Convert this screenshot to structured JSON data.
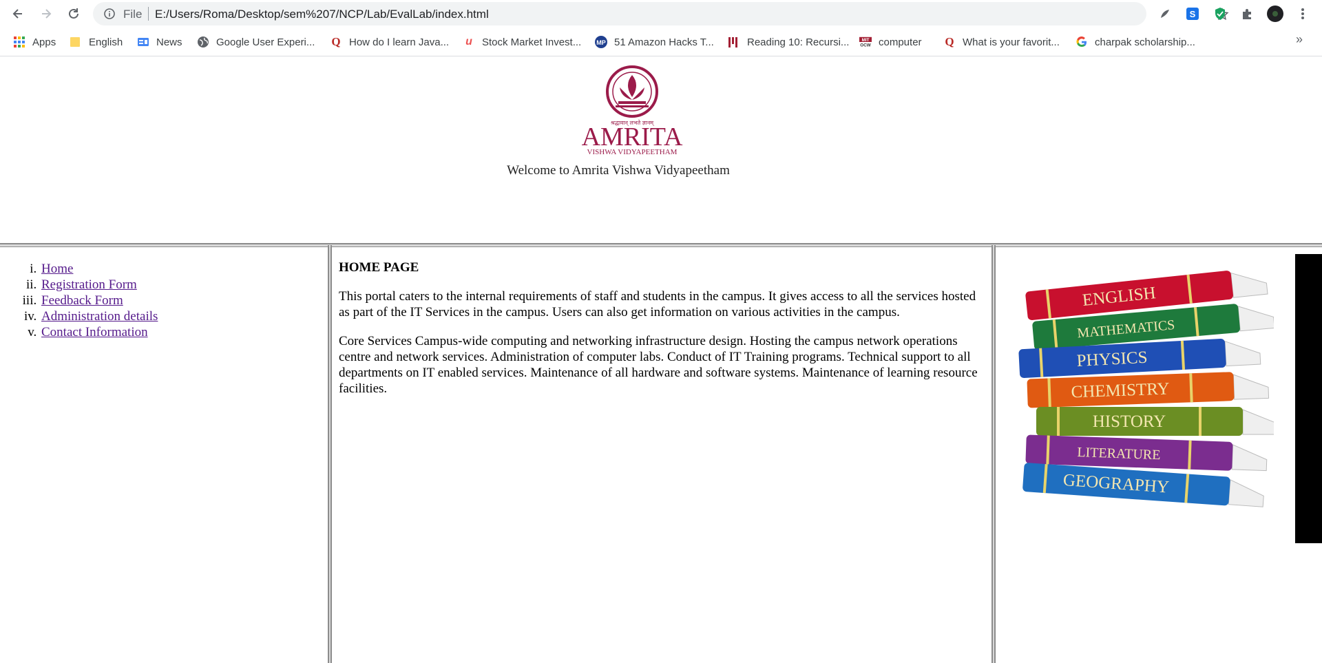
{
  "browser": {
    "scheme_label": "File",
    "url": "E:/Users/Roma/Desktop/sem%207/NCP/Lab/EvalLab/index.html",
    "bookmarks": [
      {
        "label": "Apps",
        "icon": "apps-grid-icon"
      },
      {
        "label": "English",
        "icon": "folder-icon"
      },
      {
        "label": "News",
        "icon": "google-news-icon"
      },
      {
        "label": "Google User Experi...",
        "icon": "globe-icon"
      },
      {
        "label": "How do I learn Java...",
        "icon": "quora-icon"
      },
      {
        "label": "Stock Market Invest...",
        "icon": "udemy-icon"
      },
      {
        "label": "51 Amazon Hacks T...",
        "icon": "mp-icon"
      },
      {
        "label": "Reading 10: Recursi...",
        "icon": "mit-reading-icon"
      },
      {
        "label": "computer",
        "icon": "mit-ocw-icon"
      },
      {
        "label": "What is your favorit...",
        "icon": "quora-icon"
      },
      {
        "label": "charpak scholarship...",
        "icon": "google-icon"
      }
    ],
    "more_label": "»"
  },
  "header": {
    "logo_title": "AMRITA",
    "logo_subtitle": "VISHWA VIDYAPEETHAM",
    "logo_motto": "श्रद्धावान् लभते ज्ञानम्",
    "welcome": "Welcome to Amrita Vishwa Vidyapeetham"
  },
  "menu": {
    "items": [
      {
        "label": "Home"
      },
      {
        "label": "Registration Form"
      },
      {
        "label": "Feedback Form"
      },
      {
        "label": "Administration details"
      },
      {
        "label": "Contact Information"
      }
    ]
  },
  "main": {
    "heading": "HOME PAGE",
    "paragraphs": [
      "This portal caters to the internal requirements of staff and students in the campus. It gives access to all the services hosted as part of the IT Services in the campus. Users can also get information on various activities in the campus.",
      "Core Services Campus-wide computing and networking infrastructure design. Hosting the campus network operations centre and network services. Administration of computer labs. Conduct of IT Training programs. Technical support to all departments on IT enabled services. Maintenance of all hardware and software systems. Maintenance of learning resource facilities."
    ]
  },
  "sidebar_image": {
    "book_titles": [
      "ENGLISH",
      "MATHEMATICS",
      "PHYSICS",
      "CHEMISTRY",
      "HISTORY",
      "LITERATURE",
      "GEOGRAPHY"
    ],
    "book_colors": [
      "#c8102e",
      "#1e7a3c",
      "#1f4fb5",
      "#e05a12",
      "#6b8e23",
      "#7b2d8f",
      "#1f6fc0"
    ]
  },
  "colors": {
    "brand": "#9b1b4a",
    "visited_link": "#551a8b"
  }
}
